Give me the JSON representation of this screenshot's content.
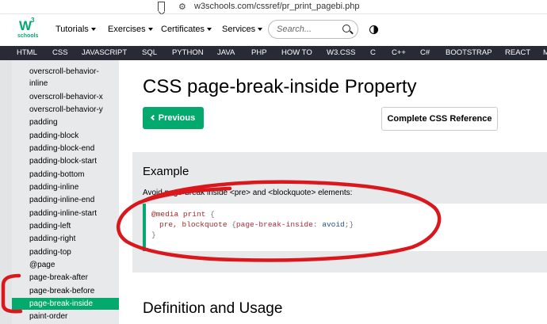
{
  "browser": {
    "url": "w3schools.com/cssref/pr_print_pagebi.php"
  },
  "logo": {
    "text": "W",
    "sup": "3",
    "sub": "schools"
  },
  "topnav": {
    "items": [
      "Tutorials",
      "Exercises",
      "Certificates",
      "Services"
    ],
    "search_placeholder": "Search..."
  },
  "darknav": [
    "HTML",
    "CSS",
    "JAVASCRIPT",
    "SQL",
    "PYTHON",
    "JAVA",
    "PHP",
    "HOW TO",
    "W3.CSS",
    "C",
    "C++",
    "C#",
    "BOOTSTRAP",
    "REACT",
    "M"
  ],
  "sidebar": {
    "items": [
      "overscroll-behavior-inline",
      "overscroll-behavior-x",
      "overscroll-behavior-y",
      "padding",
      "padding-block",
      "padding-block-end",
      "padding-block-start",
      "padding-bottom",
      "padding-inline",
      "padding-inline-end",
      "padding-inline-start",
      "padding-left",
      "padding-right",
      "padding-top",
      "@page",
      "page-break-after",
      "page-break-before",
      "page-break-inside",
      "paint-order"
    ],
    "active": "page-break-inside"
  },
  "main": {
    "title": "CSS page-break-inside Property",
    "prev_label": "Previous",
    "ref_label": "Complete CSS Reference",
    "example": {
      "title": "Example",
      "desc": "Avoid page-break inside <pre> and <blockquote> elements:",
      "code": {
        "line1_rule": "@media print",
        "line1_brace": " {",
        "line2_selector": "pre, blockquote ",
        "line2_open": "{",
        "line2_prop": "page-break-inside",
        "line2_colon": ": ",
        "line2_value": "avoid",
        "line2_close": ";}",
        "line3": "}"
      }
    },
    "section_title": "Definition and Usage"
  },
  "colors": {
    "accent": "#04AA6D",
    "darknav": "#282A35",
    "sidebar": "#E7E9EB",
    "annotation": "#d9171c"
  }
}
